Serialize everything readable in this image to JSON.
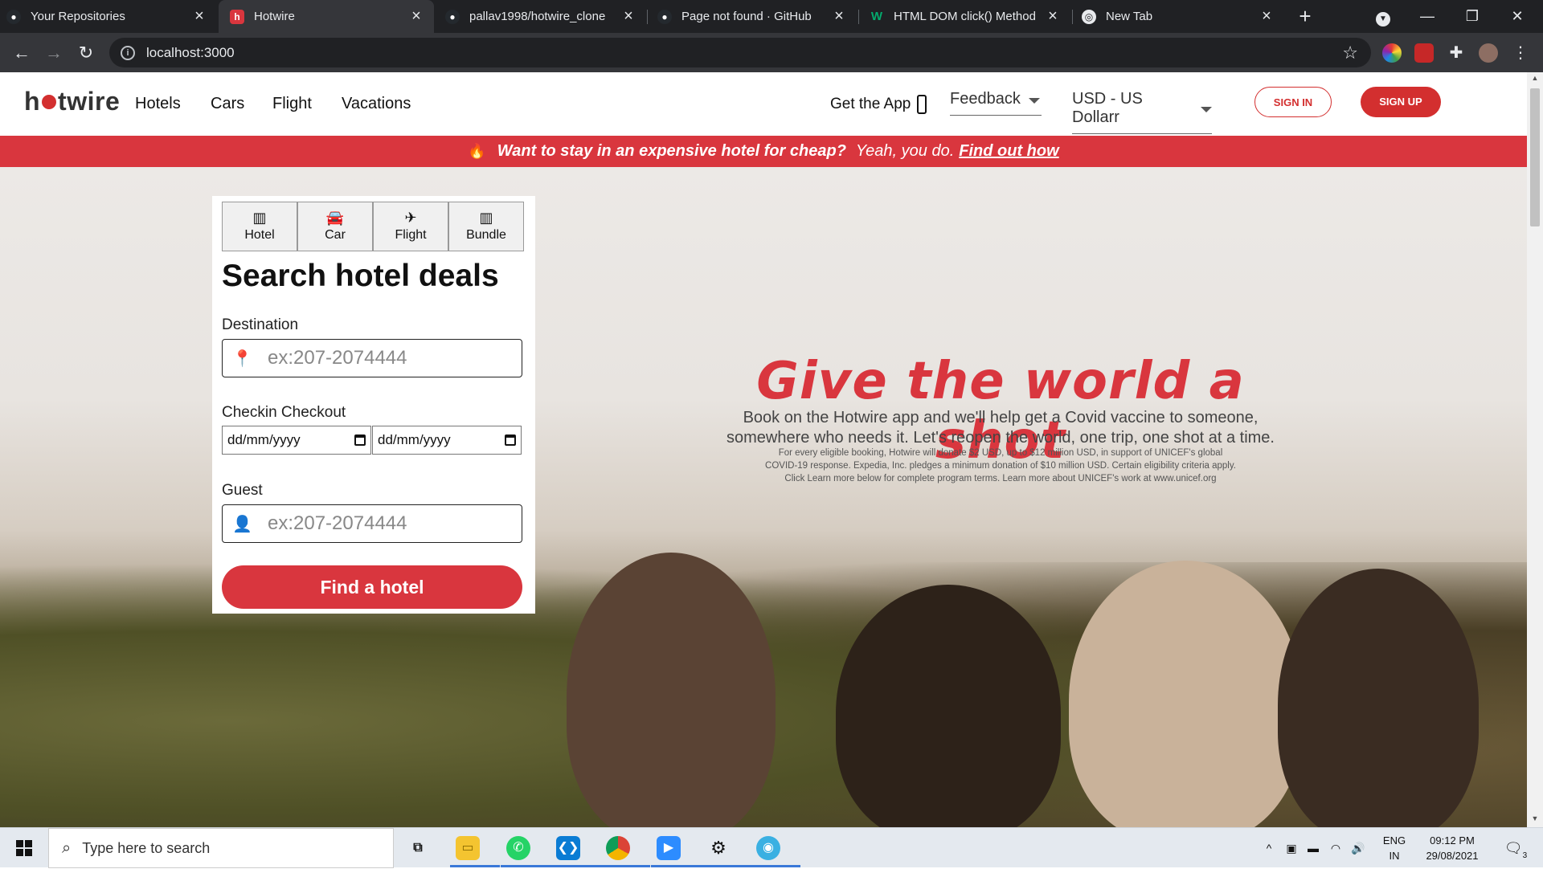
{
  "browser": {
    "tabs": [
      {
        "title": "Your Repositories",
        "favicon": "github-icon",
        "active": false
      },
      {
        "title": "Hotwire",
        "favicon": "hotwire-icon",
        "active": true
      },
      {
        "title": "pallav1998/hotwire_clone",
        "favicon": "github-icon",
        "active": false
      },
      {
        "title": "Page not found · GitHub",
        "favicon": "github-icon",
        "active": false
      },
      {
        "title": "HTML DOM click() Method",
        "favicon": "w3schools-icon",
        "active": false
      },
      {
        "title": "New Tab",
        "favicon": "chrome-icon",
        "active": false
      }
    ],
    "url": "localhost:3000"
  },
  "header": {
    "logo_pre": "h",
    "logo_post": "twire",
    "nav": [
      "Hotels",
      "Cars",
      "Flight",
      "Vacations"
    ],
    "get_app": "Get the App",
    "feedback": "Feedback",
    "currency": "USD - US Dollarr",
    "sign_in": "SIGN IN",
    "sign_up": "SIGN UP"
  },
  "promo": {
    "headline": "Want to stay in an expensive hotel for cheap?",
    "sub": "Yeah, you do.",
    "link": "Find out how"
  },
  "hero": {
    "title": "Give the world a shot",
    "subtitle_1": "Book on the Hotwire app and we'll help get a Covid vaccine to someone,",
    "subtitle_2": "somewhere who needs it. Let's reopen the world, one trip, one shot at a time.",
    "fine_1": "For every eligible booking, Hotwire will donate $2 USD, up to $12 million USD, in support of UNICEF's global",
    "fine_2": "COVID-19 response. Expedia, Inc. pledges a minimum donation of $10 million USD. Certain eligibility criteria apply.",
    "fine_3": "Click Learn more below for complete program terms. Learn more about UNICEF's work at www.unicef.org"
  },
  "search": {
    "tabs": [
      "Hotel",
      "Car",
      "Flight",
      "Bundle"
    ],
    "heading": "Search hotel deals",
    "destination_label": "Destination",
    "destination_placeholder": "ex:207-2074444",
    "dates_label": "Checkin Checkout",
    "checkin_placeholder": "dd/mm/yyyy",
    "checkout_placeholder": "dd/mm/yyyy",
    "guest_label": "Guest",
    "guest_placeholder": "ex:207-2074444",
    "submit": "Find a hotel"
  },
  "taskbar": {
    "search_placeholder": "Type here to search",
    "lang_1": "ENG",
    "lang_2": "IN",
    "time": "09:12 PM",
    "date": "29/08/2021",
    "notifications": "3"
  },
  "colors": {
    "brand_red": "#d9363e",
    "chrome_dark": "#202124"
  }
}
